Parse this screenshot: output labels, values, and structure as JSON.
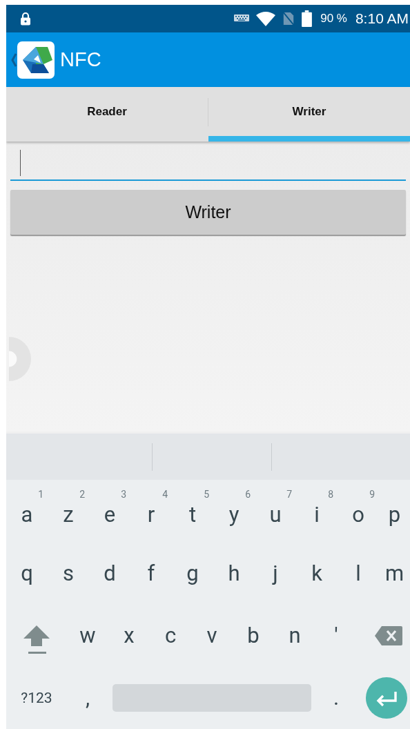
{
  "status_bar": {
    "battery": "90 %",
    "time": "8:10 AM"
  },
  "app_bar": {
    "title": "NFC"
  },
  "tabs": [
    {
      "label": "Reader",
      "selected": false
    },
    {
      "label": "Writer",
      "selected": true
    }
  ],
  "text_field": {
    "focused": true
  },
  "write_button": {
    "label": "Writer"
  },
  "keyboard": {
    "rows": [
      [
        {
          "kind": "char",
          "label": "a",
          "hint": "1"
        },
        {
          "kind": "char",
          "label": "z",
          "hint": "2"
        },
        {
          "kind": "char",
          "label": "e",
          "hint": "3"
        },
        {
          "kind": "char",
          "label": "r",
          "hint": "4"
        },
        {
          "kind": "char",
          "label": "t",
          "hint": "5"
        },
        {
          "kind": "char",
          "label": "y",
          "hint": "6"
        },
        {
          "kind": "char",
          "label": "u",
          "hint": "7"
        },
        {
          "kind": "char",
          "label": "i",
          "hint": "8"
        },
        {
          "kind": "char",
          "label": "o",
          "hint": "9"
        },
        {
          "kind": "char",
          "label": "p"
        }
      ],
      [
        {
          "kind": "char",
          "label": "q"
        },
        {
          "kind": "char",
          "label": "s"
        },
        {
          "kind": "char",
          "label": "d"
        },
        {
          "kind": "char",
          "label": "f"
        },
        {
          "kind": "char",
          "label": "g"
        },
        {
          "kind": "char",
          "label": "h"
        },
        {
          "kind": "char",
          "label": "j"
        },
        {
          "kind": "char",
          "label": "k"
        },
        {
          "kind": "char",
          "label": "l"
        },
        {
          "kind": "char",
          "label": "m"
        }
      ],
      [
        {
          "kind": "shift"
        },
        {
          "kind": "char",
          "label": "w"
        },
        {
          "kind": "char",
          "label": "x"
        },
        {
          "kind": "char",
          "label": "c"
        },
        {
          "kind": "char",
          "label": "v"
        },
        {
          "kind": "char",
          "label": "b"
        },
        {
          "kind": "char",
          "label": "n"
        },
        {
          "kind": "char",
          "label": "'"
        },
        {
          "kind": "backspace"
        }
      ],
      [
        {
          "kind": "mode",
          "label": "?123"
        },
        {
          "kind": "char",
          "label": ","
        },
        {
          "kind": "space"
        },
        {
          "kind": "char",
          "label": "."
        },
        {
          "kind": "enter"
        }
      ]
    ]
  }
}
